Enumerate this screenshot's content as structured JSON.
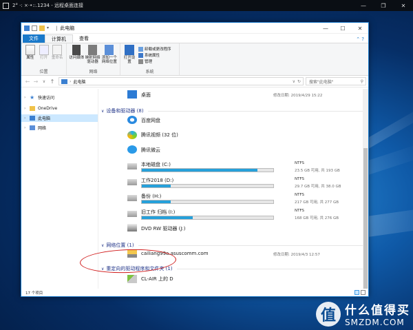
{
  "remote": {
    "title": "2° ·: ×·•::.1234 - 远程桌面连接",
    "minimize": "—",
    "restore": "❐",
    "close": "✕"
  },
  "window": {
    "title": "此电脑",
    "controls": {
      "minimize": "—",
      "maximize": "☐",
      "close": "✕"
    },
    "tabs": [
      "文件",
      "计算机",
      "查看"
    ],
    "ribbon": {
      "location_group": "位置",
      "network_group": "网络",
      "system_group": "系统",
      "buttons": {
        "properties": "属性",
        "open": "打开",
        "rename": "重命名",
        "access_media": "访问媒体",
        "map_drive": "映射网络驱动器",
        "add_location": "添加一个网络位置",
        "open_settings": "打开设置"
      },
      "small": {
        "uninstall": "卸载或更改程序",
        "sys_props": "系统属性",
        "manage": "管理"
      }
    },
    "address": {
      "path": "此电脑",
      "search_placeholder": "搜索\"此电脑\""
    },
    "nav": [
      {
        "label": "快速访问"
      },
      {
        "label": "OneDrive"
      },
      {
        "label": "此电脑"
      },
      {
        "label": "网络"
      }
    ],
    "content": {
      "desktop": {
        "name": "桌面",
        "meta": "修改日期: 2019/4/29 15:22"
      },
      "devices_header": "设备和驱动器 (8)",
      "baidu": "百度网盘",
      "tencent_video": "腾讯视频 (32 位)",
      "weiyun": "腾讯微云",
      "drives": [
        {
          "name": "本地磁盘 (C:)",
          "fs": "NTFS",
          "free": "23.5 GB 可用, 共 193 GB",
          "used_fraction": 0.88
        },
        {
          "name": "工作2018 (D:)",
          "fs": "NTFS",
          "free": "29.7 GB 可用, 共 38.0 GB",
          "used_fraction": 0.22
        },
        {
          "name": "备份 (H:)",
          "fs": "NTFS",
          "free": "217 GB 可用, 共 277 GB",
          "used_fraction": 0.22
        },
        {
          "name": "旧工作 归档 (I:)",
          "fs": "NTFS",
          "free": "168 GB 可用, 共 276 GB",
          "used_fraction": 0.39
        }
      ],
      "dvd": "DVD RW 驱动器 (J:)",
      "network_header": "网络位置 (1)",
      "net_item": {
        "name": "cailiang99a.asuscomm.com",
        "meta": "修改日期: 2019/4/3 12:57"
      },
      "redirect_header": "重定向的驱动程序和文件夹 (1)",
      "redirect_item": "CL-AIR 上的 D"
    },
    "status": "17 个项目"
  },
  "watermark": {
    "logo": "值",
    "line1": "什么值得买",
    "line2": "SMZDM.COM"
  },
  "colors": {
    "accent": "#1979ca",
    "bar_fill": "#26a0da",
    "annotation": "#d01818"
  }
}
